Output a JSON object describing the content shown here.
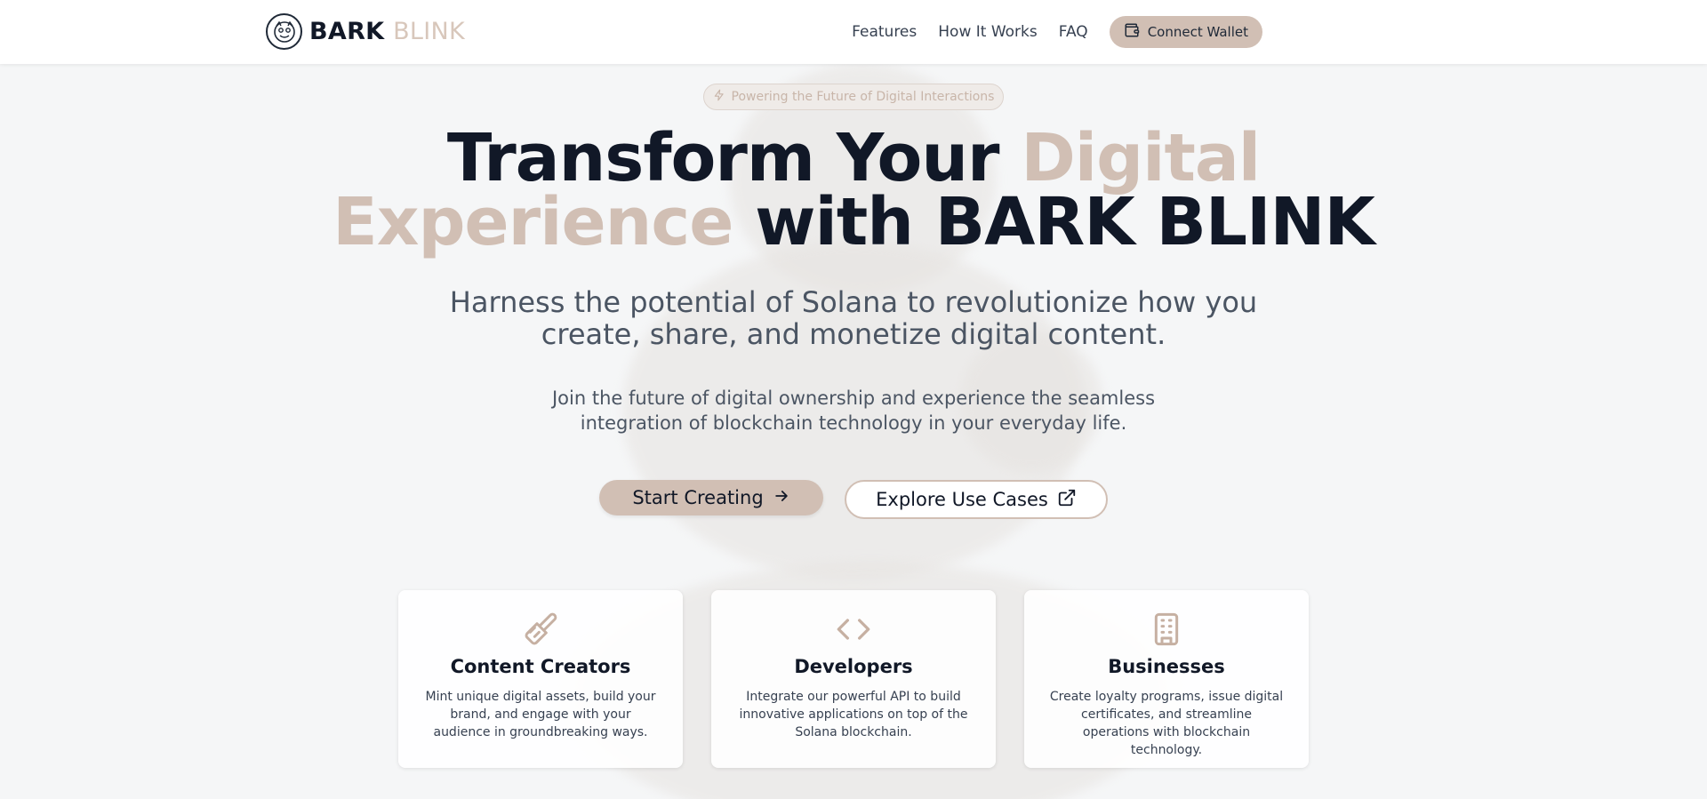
{
  "brand": {
    "primary": "BARK",
    "secondary": "BLINK",
    "accent_color": "#d1bfb4"
  },
  "nav": {
    "items": [
      {
        "label": "Features"
      },
      {
        "label": "How It Works"
      },
      {
        "label": "FAQ"
      }
    ],
    "connect_label": "Connect Wallet",
    "connect_icon": "wallet-icon"
  },
  "hero": {
    "badge": "Powering the Future of Digital Interactions",
    "badge_icon": "lightning-icon",
    "title_part1": "Transform Your ",
    "title_accent": "Digital Experience",
    "title_part2": " with BARK BLINK",
    "subtitle": "Harness the potential of Solana to revolutionize how you create, share, and monetize digital content.",
    "lead": "Join the future of digital ownership and experience the seamless integration of blockchain technology in your everyday life.",
    "primary_cta": "Start Creating",
    "primary_cta_icon": "arrow-right-icon",
    "secondary_cta": "Explore Use Cases",
    "secondary_cta_icon": "external-link-icon"
  },
  "cards": [
    {
      "icon": "paintbrush-icon",
      "title": "Content Creators",
      "desc": "Mint unique digital assets, build your brand, and engage with your audience in groundbreaking ways."
    },
    {
      "icon": "code-icon",
      "title": "Developers",
      "desc": "Integrate our powerful API to build innovative applications on top of the Solana blockchain."
    },
    {
      "icon": "building-icon",
      "title": "Businesses",
      "desc": "Create loyalty programs, issue digital certificates, and streamline operations with blockchain technology."
    }
  ]
}
